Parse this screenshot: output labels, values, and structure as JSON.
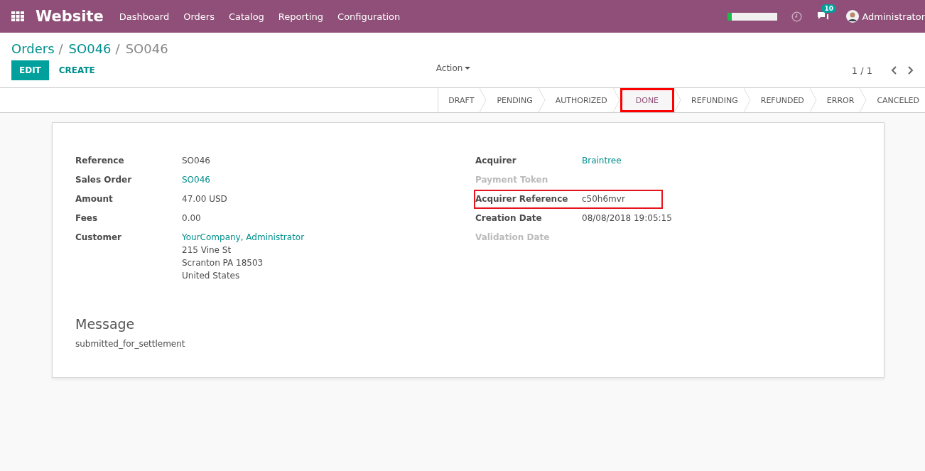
{
  "navbar": {
    "app_title": "Website",
    "menu": [
      "Dashboard",
      "Orders",
      "Catalog",
      "Reporting",
      "Configuration"
    ],
    "progress": {
      "level": 0.08
    },
    "messages_badge": "10",
    "user": "Administrator"
  },
  "breadcrumbs": [
    {
      "label": "Orders",
      "current": false,
      "separator": "/"
    },
    {
      "label": "SO046",
      "current": false,
      "separator": "/"
    },
    {
      "label": "SO046",
      "current": true
    }
  ],
  "buttons": {
    "edit": "EDIT",
    "create": "CREATE",
    "action": "Action"
  },
  "pager": "1 / 1",
  "status_steps": [
    {
      "label": "DRAFT",
      "selected": false,
      "highlighted": false
    },
    {
      "label": "PENDING",
      "selected": false,
      "highlighted": false
    },
    {
      "label": "AUTHORIZED",
      "selected": false,
      "highlighted": false
    },
    {
      "label": "DONE",
      "selected": true,
      "highlighted": true
    },
    {
      "label": "REFUNDING",
      "selected": false,
      "highlighted": false
    },
    {
      "label": "REFUNDED",
      "selected": false,
      "highlighted": false
    },
    {
      "label": "ERROR",
      "selected": false,
      "highlighted": false
    },
    {
      "label": "CANCELED",
      "selected": false,
      "highlighted": false
    }
  ],
  "left_fields": [
    {
      "label": "Reference",
      "kind": "text",
      "values": [
        "SO046"
      ],
      "empty": false,
      "highlighted": false
    },
    {
      "label": "Sales Order",
      "kind": "link",
      "values": [
        "SO046"
      ],
      "empty": false,
      "highlighted": false
    },
    {
      "label": "Amount",
      "kind": "text",
      "values": [
        "47.00 USD"
      ],
      "empty": false,
      "highlighted": false
    },
    {
      "label": "Fees",
      "kind": "text",
      "values": [
        "0.00"
      ],
      "empty": false,
      "highlighted": false
    },
    {
      "label": "Customer",
      "kind": "address",
      "values": [
        "YourCompany, Administrator",
        "215 Vine St",
        "Scranton PA 18503",
        "United States"
      ],
      "empty": false,
      "highlighted": false
    }
  ],
  "right_fields": [
    {
      "label": "Acquirer",
      "kind": "link",
      "values": [
        "Braintree"
      ],
      "empty": false,
      "highlighted": false
    },
    {
      "label": "Payment Token",
      "empty": true,
      "highlighted": false
    },
    {
      "label": "Acquirer Reference",
      "kind": "text",
      "values": [
        "c50h6mvr"
      ],
      "empty": false,
      "highlighted": true
    },
    {
      "label": "Creation Date",
      "kind": "text",
      "values": [
        "08/08/2018 19:05:15"
      ],
      "empty": false,
      "highlighted": false
    },
    {
      "label": "Validation Date",
      "empty": true,
      "highlighted": false
    }
  ],
  "message": {
    "title": "Message",
    "text": "submitted_for_settlement"
  }
}
